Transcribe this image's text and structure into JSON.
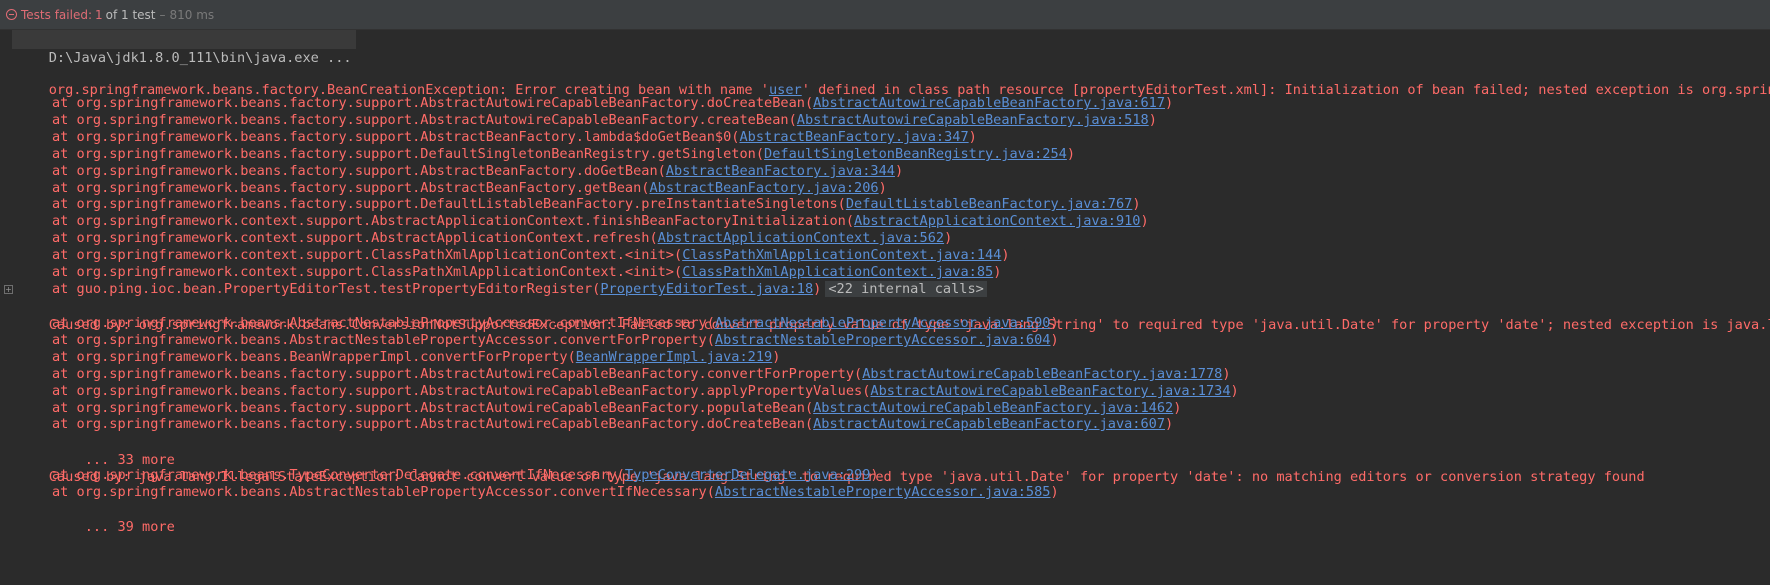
{
  "status": {
    "label": "Tests failed:",
    "count": "1",
    "of_text": "of 1 test",
    "separator": "–",
    "time": "810 ms"
  },
  "console": {
    "command": "D:\\Java\\jdk1.8.0_111\\bin\\java.exe ...",
    "exception": {
      "prefix": "org.springframework.beans.factory.BeanCreationException: Error creating bean with name '",
      "bean": "user",
      "suffix": "' defined in class path resource [propertyEditorTest.xml]: Initialization of bean failed; nested exception is org.springframework.beans.ConversionNotSupportedException"
    },
    "trace1": [
      {
        "prefix": "at org.springframework.beans.factory.support.AbstractAutowireCapableBeanFactory.doCreateBean(",
        "link": "AbstractAutowireCapableBeanFactory.java:617",
        "suffix": ")"
      },
      {
        "prefix": "at org.springframework.beans.factory.support.AbstractAutowireCapableBeanFactory.createBean(",
        "link": "AbstractAutowireCapableBeanFactory.java:518",
        "suffix": ")"
      },
      {
        "prefix": "at org.springframework.beans.factory.support.AbstractBeanFactory.lambda$doGetBean$0(",
        "link": "AbstractBeanFactory.java:347",
        "suffix": ")"
      },
      {
        "prefix": "at org.springframework.beans.factory.support.DefaultSingletonBeanRegistry.getSingleton(",
        "link": "DefaultSingletonBeanRegistry.java:254",
        "suffix": ")"
      },
      {
        "prefix": "at org.springframework.beans.factory.support.AbstractBeanFactory.doGetBean(",
        "link": "AbstractBeanFactory.java:344",
        "suffix": ")"
      },
      {
        "prefix": "at org.springframework.beans.factory.support.AbstractBeanFactory.getBean(",
        "link": "AbstractBeanFactory.java:206",
        "suffix": ")"
      },
      {
        "prefix": "at org.springframework.beans.factory.support.DefaultListableBeanFactory.preInstantiateSingletons(",
        "link": "DefaultListableBeanFactory.java:767",
        "suffix": ")"
      },
      {
        "prefix": "at org.springframework.context.support.AbstractApplicationContext.finishBeanFactoryInitialization(",
        "link": "AbstractApplicationContext.java:910",
        "suffix": ")"
      },
      {
        "prefix": "at org.springframework.context.support.AbstractApplicationContext.refresh(",
        "link": "AbstractApplicationContext.java:562",
        "suffix": ")"
      },
      {
        "prefix": "at org.springframework.context.support.ClassPathXmlApplicationContext.<init>(",
        "link": "ClassPathXmlApplicationContext.java:144",
        "suffix": ")"
      },
      {
        "prefix": "at org.springframework.context.support.ClassPathXmlApplicationContext.<init>(",
        "link": "ClassPathXmlApplicationContext.java:85",
        "suffix": ")"
      },
      {
        "prefix": "at guo.ping.ioc.bean.PropertyEditorTest.testPropertyEditorRegister(",
        "link": "PropertyEditorTest.java:18",
        "suffix": ")",
        "internal": "<22 internal calls>",
        "fold": "+"
      }
    ],
    "caused1": "Caused by: org.springframework.beans.ConversionNotSupportedException: Failed to convert property value of type 'java.lang.String' to required type 'java.util.Date' for property 'date'; nested exception is java.lang.IllegalStateException",
    "trace2": [
      {
        "prefix": "at org.springframework.beans.AbstractNestablePropertyAccessor.convertIfNecessary(",
        "link": "AbstractNestablePropertyAccessor.java:590",
        "suffix": ")"
      },
      {
        "prefix": "at org.springframework.beans.AbstractNestablePropertyAccessor.convertForProperty(",
        "link": "AbstractNestablePropertyAccessor.java:604",
        "suffix": ")"
      },
      {
        "prefix": "at org.springframework.beans.BeanWrapperImpl.convertForProperty(",
        "link": "BeanWrapperImpl.java:219",
        "suffix": ")"
      },
      {
        "prefix": "at org.springframework.beans.factory.support.AbstractAutowireCapableBeanFactory.convertForProperty(",
        "link": "AbstractAutowireCapableBeanFactory.java:1778",
        "suffix": ")"
      },
      {
        "prefix": "at org.springframework.beans.factory.support.AbstractAutowireCapableBeanFactory.applyPropertyValues(",
        "link": "AbstractAutowireCapableBeanFactory.java:1734",
        "suffix": ")"
      },
      {
        "prefix": "at org.springframework.beans.factory.support.AbstractAutowireCapableBeanFactory.populateBean(",
        "link": "AbstractAutowireCapableBeanFactory.java:1462",
        "suffix": ")"
      },
      {
        "prefix": "at org.springframework.beans.factory.support.AbstractAutowireCapableBeanFactory.doCreateBean(",
        "link": "AbstractAutowireCapableBeanFactory.java:607",
        "suffix": ")"
      }
    ],
    "more1": "... 33 more",
    "caused2": "Caused by: java.lang.IllegalStateException: Cannot convert value of type 'java.lang.String' to required type 'java.util.Date' for property 'date': no matching editors or conversion strategy found",
    "trace3": [
      {
        "prefix": "at org.springframework.beans.TypeConverterDelegate.convertIfNecessary(",
        "link": "TypeConverterDelegate.java:299",
        "suffix": ")"
      },
      {
        "prefix": "at org.springframework.beans.AbstractNestablePropertyAccessor.convertIfNecessary(",
        "link": "AbstractNestablePropertyAccessor.java:585",
        "suffix": ")"
      }
    ],
    "more2": "... 39 more"
  },
  "colors": {
    "background": "#2b2b2b",
    "error_text": "#ff6b68",
    "link": "#5a8fd6",
    "status_fail": "#e06c75"
  }
}
